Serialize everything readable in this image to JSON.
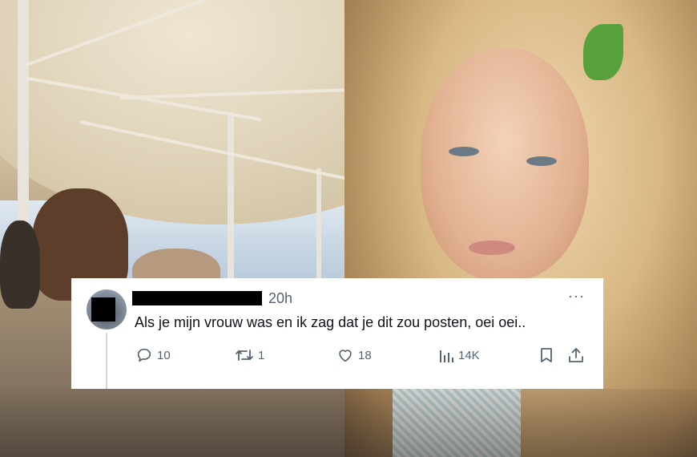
{
  "tweet": {
    "time": "20h",
    "more": "···",
    "text": "Als je mijn vrouw was en ik zag dat je dit zou posten, oei oei..",
    "actions": {
      "replies": "10",
      "reposts": "1",
      "likes": "18",
      "views": "14K"
    }
  },
  "icons": [
    "reply-icon",
    "repost-icon",
    "like-icon",
    "views-icon",
    "bookmark-icon",
    "share-icon"
  ]
}
